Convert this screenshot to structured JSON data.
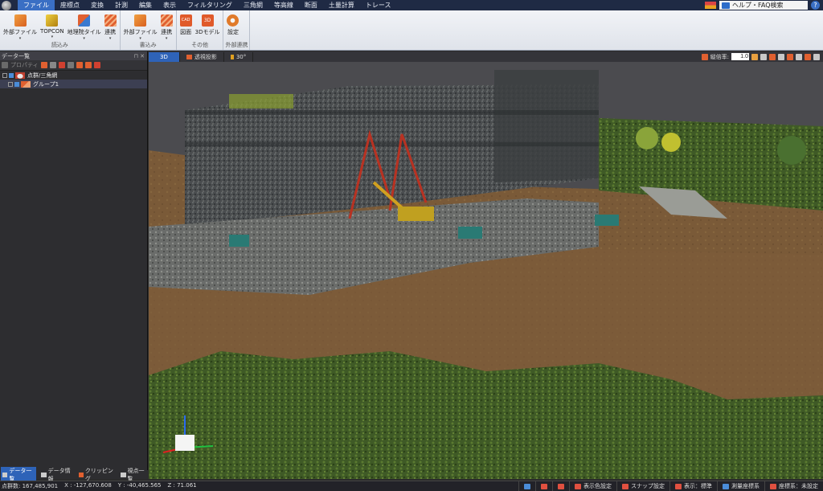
{
  "menu": {
    "items": [
      "ファイル",
      "座標点",
      "変換",
      "計測",
      "編集",
      "表示",
      "フィルタリング",
      "三角網",
      "等高線",
      "断面",
      "土量計算",
      "トレース"
    ],
    "active_index": 0,
    "help_search_label": "ヘルプ・FAQ検索"
  },
  "ribbon": {
    "groups": [
      {
        "label": "読込み",
        "buttons": [
          {
            "label": "外部ファイル",
            "icon": "file-import-icon",
            "color": "#e07a2a",
            "dropdown": true
          },
          {
            "label": "TOPCON",
            "icon": "topcon-icon",
            "color": "#d8b020",
            "dropdown": true
          },
          {
            "label": "地理院タイル",
            "icon": "gsi-tile-icon",
            "color": "#3a7ad0",
            "dropdown": true
          },
          {
            "label": "連携",
            "icon": "link-icon",
            "color": "#e06030",
            "dropdown": true
          }
        ]
      },
      {
        "label": "書込み",
        "buttons": [
          {
            "label": "外部ファイル",
            "icon": "file-export-icon",
            "color": "#e07a2a",
            "dropdown": true
          },
          {
            "label": "連携",
            "icon": "link-export-icon",
            "color": "#e06030",
            "dropdown": true
          }
        ]
      },
      {
        "label": "その他",
        "buttons": [
          {
            "label": "図面",
            "icon": "cad-icon",
            "color": "#e05a2a",
            "dropdown": false
          },
          {
            "label": "3Dモデル",
            "icon": "3d-model-icon",
            "color": "#e05a2a",
            "dropdown": false
          }
        ]
      },
      {
        "label": "外部連携",
        "buttons": [
          {
            "label": "設定",
            "icon": "gear-icon",
            "color": "#e07a2a",
            "dropdown": false
          }
        ]
      }
    ]
  },
  "leftpanel": {
    "title": "データ一覧",
    "tool_label": "プロパティ",
    "tree": [
      {
        "label": "点群/三角網",
        "icon": "cloud-icon"
      },
      {
        "label": "グループ1",
        "icon": "group-icon"
      }
    ]
  },
  "viewport": {
    "tabs": [
      "3D",
      "透視投影",
      "30°"
    ],
    "scale_label": "縦倍率:",
    "scale_value": "1.0"
  },
  "bottom_tabs": [
    "データ一覧",
    "データ情報",
    "クリッピング",
    "視点一覧"
  ],
  "status": {
    "points": "点群数: 167,485,901",
    "x": "X : -127,670.608",
    "y": "Y : -40,465.565",
    "z": "Z : 71.061",
    "buttons": [
      "表示色設定",
      "スナップ設定",
      "表示：標準",
      "測量座標系",
      "座標系：未設定"
    ]
  },
  "colors": {
    "accent": "#2e63b8",
    "menubar": "#1f2a44"
  }
}
